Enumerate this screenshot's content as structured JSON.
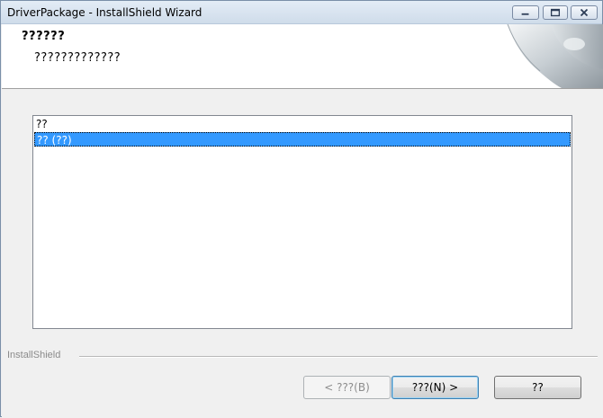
{
  "window": {
    "title": "DriverPackage - InstallShield Wizard"
  },
  "banner": {
    "heading": "??????",
    "subheading": "?????????????"
  },
  "list": {
    "items": [
      "??",
      "?? (??)"
    ],
    "selected_index": 1
  },
  "footer": {
    "brand": "InstallShield",
    "back_label": "< ???(B)",
    "next_label": "???(N) >",
    "cancel_label": "??"
  },
  "colors": {
    "selection": "#3399ff",
    "titlebar": "#dbe6f2"
  }
}
